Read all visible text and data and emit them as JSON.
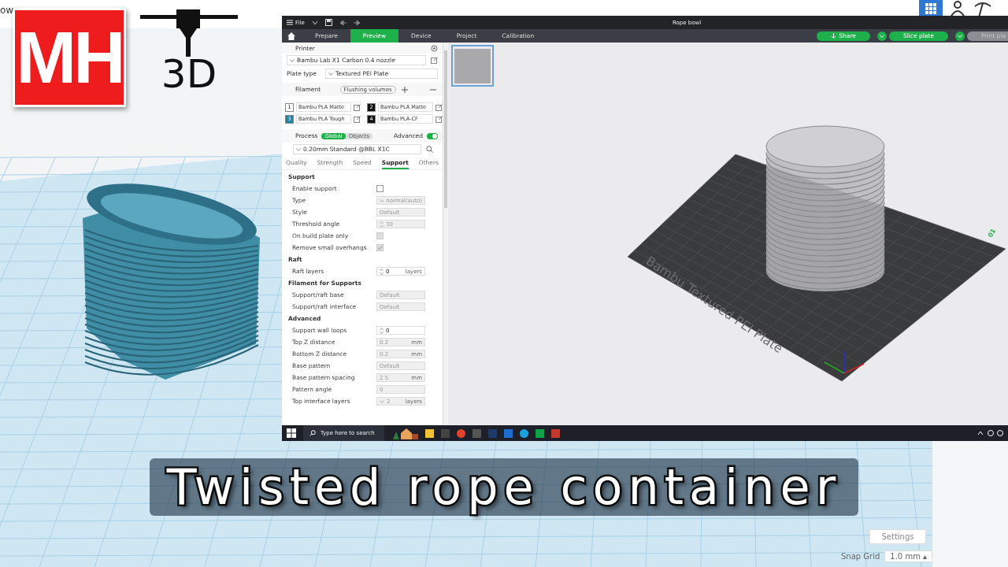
{
  "logo": {
    "letters": "MH",
    "mark": "3D"
  },
  "background_app": {
    "title_fragment": "ow",
    "settings_button": "Settings",
    "snap_grid": {
      "label": "Snap Grid",
      "value": "1.0 mm ▴"
    }
  },
  "slicer": {
    "title": "Rope bowl",
    "menu": "File",
    "tabs": [
      {
        "label": "Prepare",
        "selected": false
      },
      {
        "label": "Preview",
        "selected": true
      },
      {
        "label": "Device",
        "selected": false
      },
      {
        "label": "Project",
        "selected": false
      },
      {
        "label": "Calibration",
        "selected": false
      }
    ],
    "actions": [
      {
        "label": "Share",
        "kind": "share",
        "disabled": false
      },
      {
        "label": "Slice plate",
        "kind": "split",
        "disabled": false
      },
      {
        "label": "Print pla",
        "kind": "split",
        "disabled": true
      }
    ],
    "printer": {
      "title": "Printer",
      "model": "Bambu Lab X1 Carbon 0.4 nozzle",
      "plate_type_label": "Plate type",
      "plate_type": "Textured PEI Plate"
    },
    "filament": {
      "title": "Filament",
      "flushing": "Flushing volumes",
      "items": [
        {
          "number": "1",
          "name": "Bambu PLA Matte",
          "color": "#ffffff"
        },
        {
          "number": "2",
          "name": "Bambu PLA Matte",
          "color": "#111111"
        },
        {
          "number": "3",
          "name": "Bambu PLA Tough",
          "color": "#1a86a8"
        },
        {
          "number": "4",
          "name": "Bambu PLA-CF",
          "color": "#111111"
        }
      ]
    },
    "process": {
      "title": "Process",
      "scopes": [
        {
          "label": "Global",
          "selected": true
        },
        {
          "label": "Objects",
          "selected": false
        }
      ],
      "advanced": {
        "label": "Advanced",
        "on": true
      },
      "profile": "0.20mm Standard @BBL X1C",
      "tabs": [
        {
          "label": "Quality",
          "selected": false
        },
        {
          "label": "Strength",
          "selected": false
        },
        {
          "label": "Speed",
          "selected": false
        },
        {
          "label": "Support",
          "selected": true
        },
        {
          "label": "Others",
          "selected": false
        }
      ]
    },
    "groups": [
      {
        "title": "Support",
        "rows": [
          {
            "kind": "checkbox",
            "label": "Enable support",
            "checked": false,
            "disabled": false
          },
          {
            "kind": "combo",
            "label": "Type",
            "value": "normal(auto)",
            "disabled": true
          },
          {
            "kind": "field",
            "label": "Style",
            "value": "Default",
            "disabled": true
          },
          {
            "kind": "spin",
            "label": "Threshold angle",
            "value": "30",
            "disabled": true
          },
          {
            "kind": "checkbox",
            "label": "On build plate only",
            "checked": false,
            "disabled": true
          },
          {
            "kind": "checkbox",
            "label": "Remove small overhangs",
            "checked": true,
            "disabled": true
          }
        ]
      },
      {
        "title": "Raft",
        "rows": [
          {
            "kind": "spin",
            "label": "Raft layers",
            "value": "0",
            "unit": "layers",
            "disabled": false
          }
        ]
      },
      {
        "title": "Filament for Supports",
        "rows": [
          {
            "kind": "field",
            "label": "Support/raft base",
            "value": "Default",
            "disabled": true
          },
          {
            "kind": "field",
            "label": "Support/raft interface",
            "value": "Default",
            "disabled": true
          }
        ]
      },
      {
        "title": "Advanced",
        "rows": [
          {
            "kind": "spin",
            "label": "Support wall loops",
            "value": "0",
            "disabled": false
          },
          {
            "kind": "field",
            "label": "Top Z distance",
            "value": "0.2",
            "unit": "mm",
            "disabled": true
          },
          {
            "kind": "field",
            "label": "Bottom Z distance",
            "value": "0.2",
            "unit": "mm",
            "disabled": true
          },
          {
            "kind": "field",
            "label": "Base pattern",
            "value": "Default",
            "disabled": true
          },
          {
            "kind": "field",
            "label": "Base pattern spacing",
            "value": "2.5",
            "unit": "mm",
            "disabled": true
          },
          {
            "kind": "field",
            "label": "Pattern angle",
            "value": "0",
            "disabled": true
          },
          {
            "kind": "combo",
            "label": "Top interface layers",
            "value": "2",
            "unit": "layers",
            "disabled": true
          }
        ]
      }
    ],
    "plates": [
      {
        "selected": true
      }
    ],
    "plate_label": "Bambu Textured PEI Plate",
    "plate_number": "01",
    "taskbar": {
      "search_placeholder": "Type here to search"
    }
  },
  "caption": "Twisted rope container"
}
